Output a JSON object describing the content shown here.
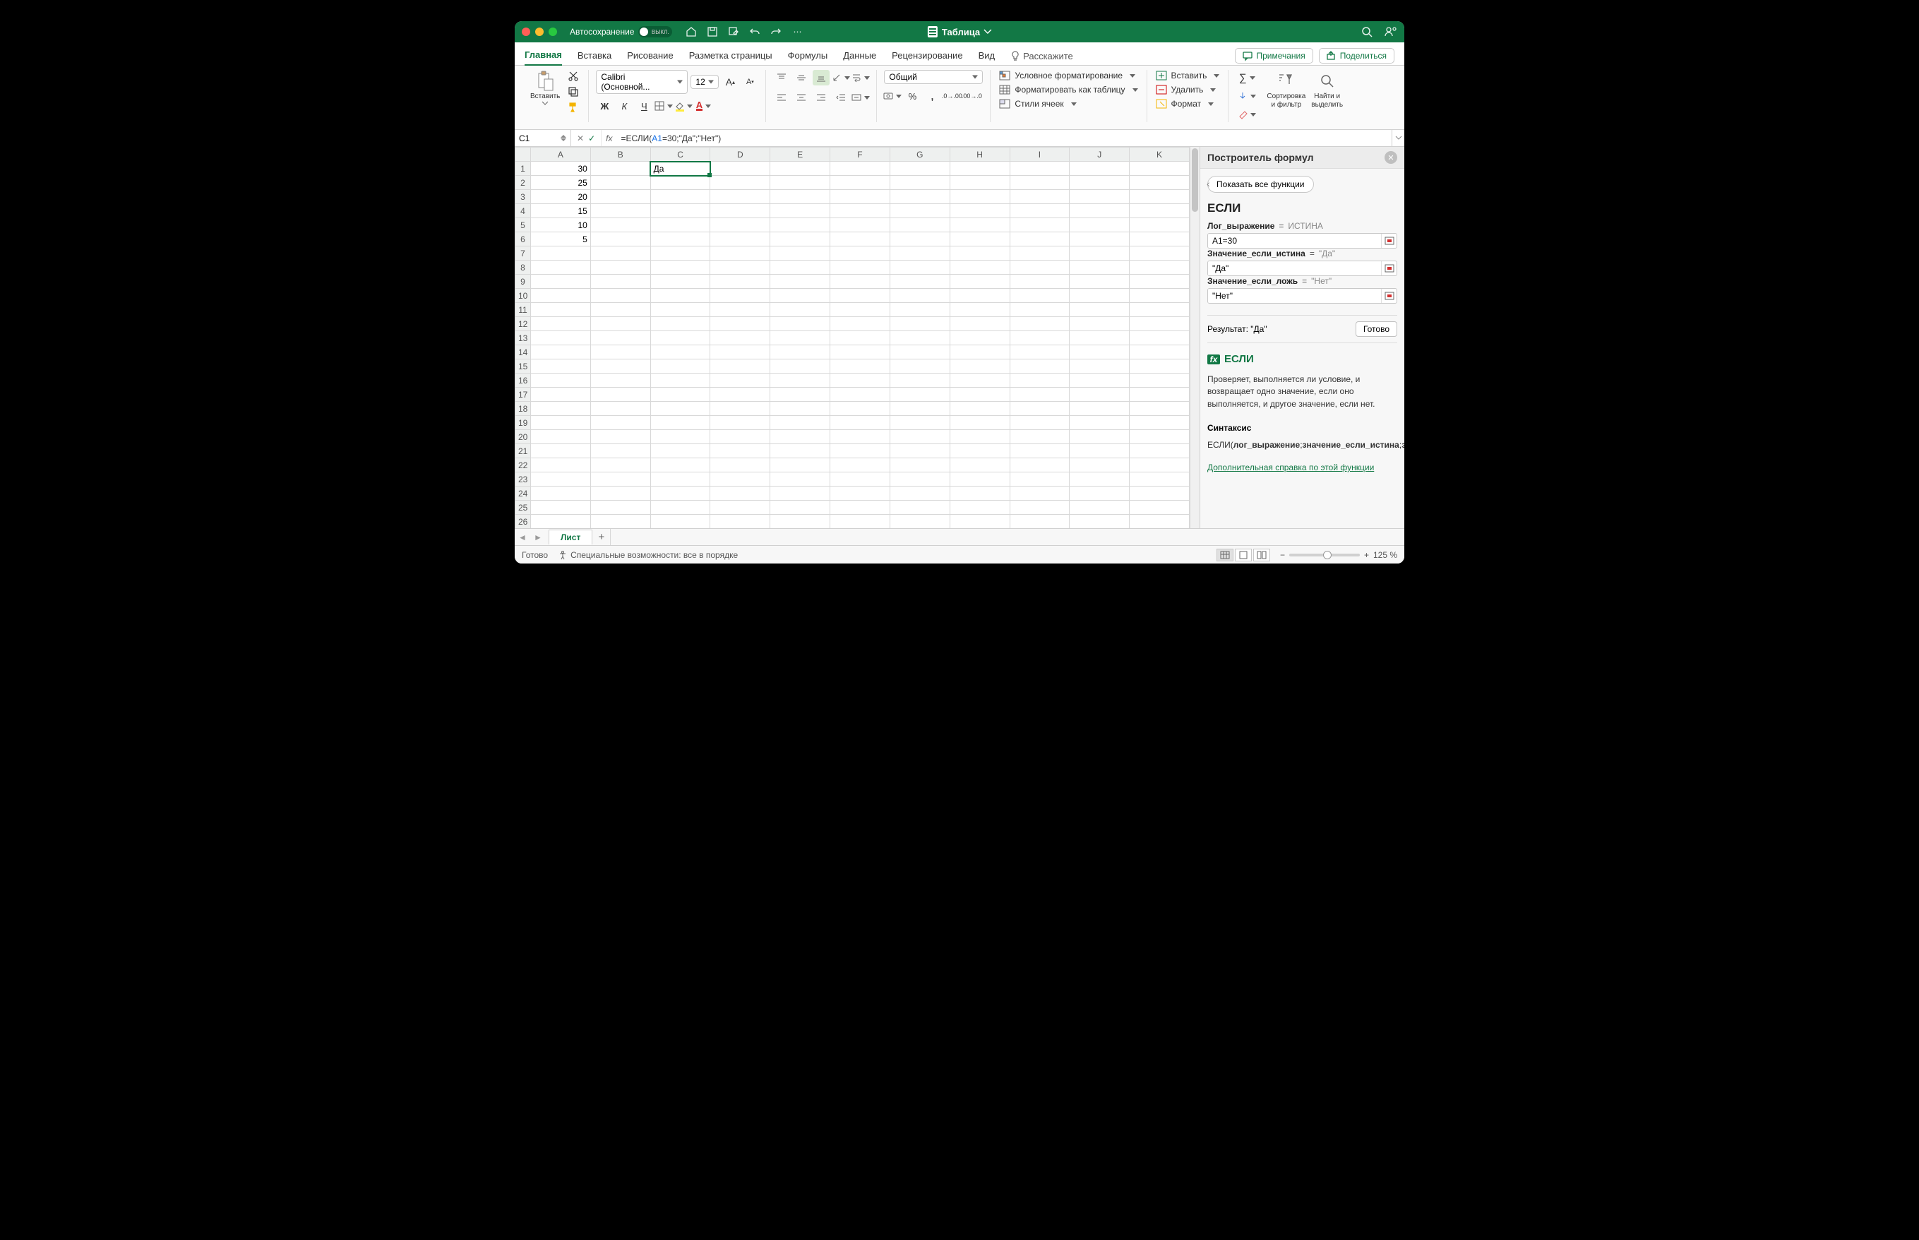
{
  "titlebar": {
    "autosave_label": "Автосохранение",
    "autosave_state": "ВЫКЛ.",
    "doc_title": "Таблица"
  },
  "tabs": {
    "items": [
      "Главная",
      "Вставка",
      "Рисование",
      "Разметка страницы",
      "Формулы",
      "Данные",
      "Рецензирование",
      "Вид"
    ],
    "active": 0,
    "tell_me": "Расскажите",
    "comments": "Примечания",
    "share": "Поделиться"
  },
  "ribbon": {
    "paste": "Вставить",
    "font_name": "Calibri (Основной...",
    "font_size": "12",
    "number_format": "Общий",
    "cond_format": "Условное форматирование",
    "format_table": "Форматировать как таблицу",
    "cell_styles": "Стили ячеек",
    "insert": "Вставить",
    "delete": "Удалить",
    "format": "Формат",
    "sort_filter": "Сортировка\nи фильтр",
    "find_select": "Найти и\nвыделить"
  },
  "formula_bar": {
    "cell_ref": "C1",
    "formula_prefix": "=ЕСЛИ(",
    "formula_arg_ref": "A1",
    "formula_suffix": "=30;\"Да\";\"Нет\")"
  },
  "grid": {
    "columns": [
      "A",
      "B",
      "C",
      "D",
      "E",
      "F",
      "G",
      "H",
      "I",
      "J",
      "K"
    ],
    "row_count": 26,
    "cells": {
      "A1": "30",
      "A2": "25",
      "A3": "20",
      "A4": "15",
      "A5": "10",
      "A6": "5",
      "C1": "Да"
    },
    "selected": "C1"
  },
  "panel": {
    "title": "Построитель формул",
    "show_all": "Показать все функции",
    "func_name": "ЕСЛИ",
    "args": [
      {
        "name": "Лог_выражение",
        "preview": "ИСТИНА",
        "value": "A1=30"
      },
      {
        "name": "Значение_если_истина",
        "preview": "\"Да\"",
        "value": "\"Да\""
      },
      {
        "name": "Значение_если_ложь",
        "preview": "\"Нет\"",
        "value": "\"Нет\""
      }
    ],
    "result_label": "Результат:",
    "result_value": "\"Да\"",
    "done": "Готово",
    "help_title": "ЕСЛИ",
    "help_body": "Проверяет, выполняется ли условие, и возвращает одно значение, если оно выполняется, и другое значение, если нет.",
    "syntax_h": "Синтаксис",
    "syntax_body": "ЕСЛИ(лог_выражение;значение_если_истина;значение_если_ложь)",
    "help_link": "Дополнительная справка по этой функции"
  },
  "sheet_tabs": {
    "active": "Лист"
  },
  "status": {
    "ready": "Готово",
    "accessibility": "Специальные возможности: все в порядке",
    "zoom": "125 %"
  }
}
